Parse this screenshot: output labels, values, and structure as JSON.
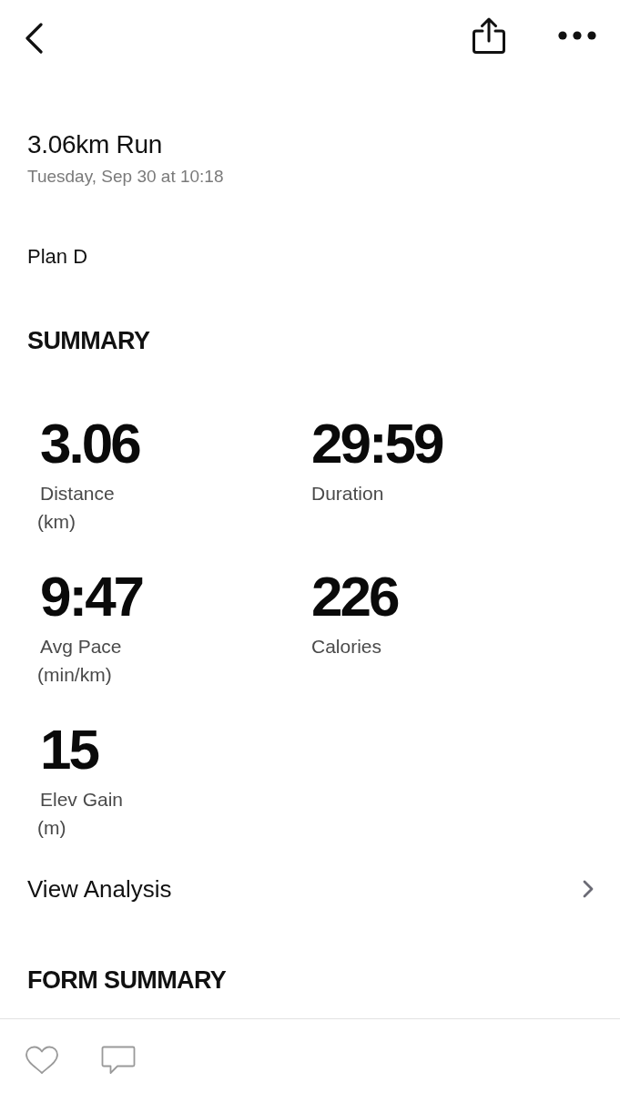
{
  "activity": {
    "title": "3.06km Run",
    "date": "Tuesday, Sep 30 at 10:18",
    "plan": "Plan D"
  },
  "summary": {
    "heading": "SUMMARY",
    "stats": [
      {
        "value": "3.06",
        "label": "Distance",
        "unit": "(km)"
      },
      {
        "value": "29:59",
        "label": "Duration"
      },
      {
        "value": "9:47",
        "label": "Avg Pace",
        "unit": "(min/km)"
      },
      {
        "value": "226",
        "label": "Calories"
      },
      {
        "value": "15",
        "label": "Elev Gain",
        "unit": "(m)"
      }
    ]
  },
  "analysis_link": {
    "label": "View Analysis"
  },
  "form_summary": {
    "heading": "FORM SUMMARY"
  }
}
